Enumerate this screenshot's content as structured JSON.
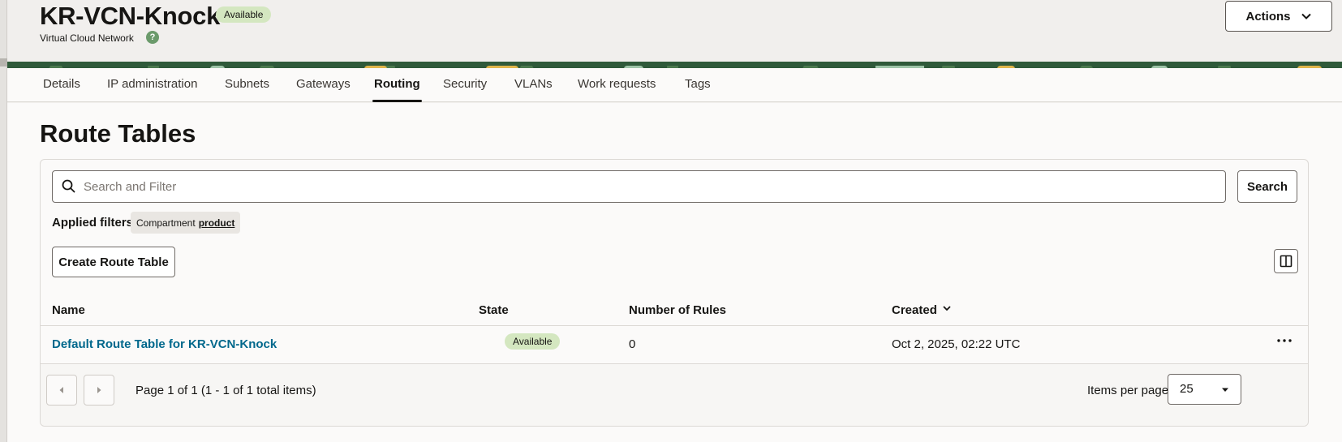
{
  "header": {
    "title": "KR-VCN-Knock",
    "status": "Available",
    "subtitle": "Virtual Cloud Network",
    "help_icon": "?",
    "actions_label": "Actions"
  },
  "tabs": [
    {
      "label": "Details"
    },
    {
      "label": "IP administration"
    },
    {
      "label": "Subnets"
    },
    {
      "label": "Gateways"
    },
    {
      "label": "Routing",
      "active": true
    },
    {
      "label": "Security"
    },
    {
      "label": "VLANs"
    },
    {
      "label": "Work requests"
    },
    {
      "label": "Tags"
    }
  ],
  "main": {
    "title": "Route Tables",
    "search": {
      "placeholder": "Search and Filter",
      "button_label": "Search",
      "icon": "search-icon"
    },
    "filters": {
      "label": "Applied filters",
      "chips": [
        {
          "name": "Compartment",
          "value": "product"
        }
      ]
    },
    "create_button": "Create Route Table",
    "table": {
      "columns": [
        "Name",
        "State",
        "Number of Rules",
        "Created"
      ],
      "sort_column": "Created",
      "rows": [
        {
          "name": "Default Route Table for KR-VCN-Knock",
          "state": "Available",
          "rules": "0",
          "created": "Oct 2, 2025, 02:22 UTC"
        }
      ]
    },
    "pagination": {
      "info": "Page 1 of 1 (1 - 1 of 1 total items)",
      "items_per_page_label": "Items per page",
      "items_per_page": "25"
    }
  },
  "colors": {
    "link": "#00688c",
    "badge_bg": "#d4e7c0",
    "banner": "#2f5a3a"
  }
}
